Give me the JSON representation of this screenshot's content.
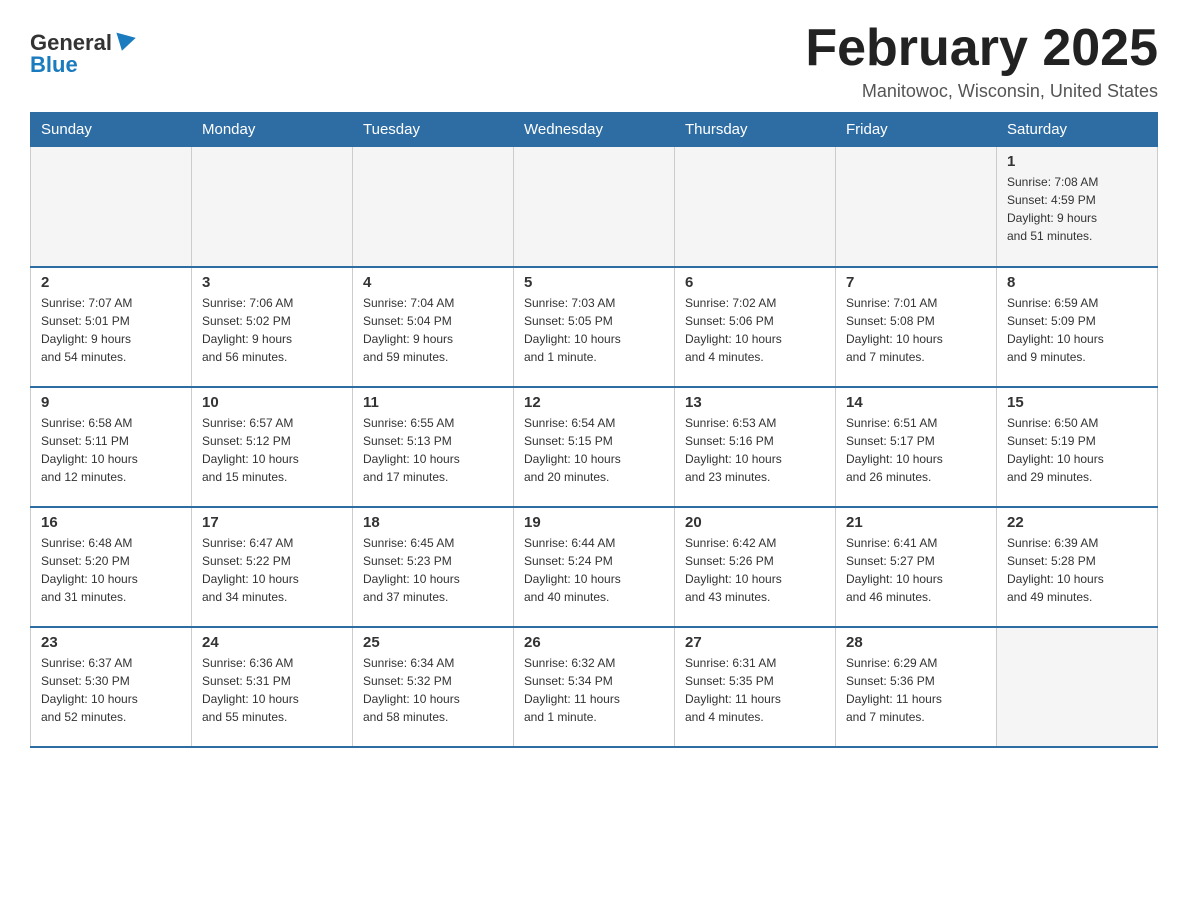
{
  "logo": {
    "text_general": "General",
    "text_blue": "Blue"
  },
  "header": {
    "month_title": "February 2025",
    "location": "Manitowoc, Wisconsin, United States"
  },
  "weekdays": [
    "Sunday",
    "Monday",
    "Tuesday",
    "Wednesday",
    "Thursday",
    "Friday",
    "Saturday"
  ],
  "weeks": [
    [
      {
        "day": "",
        "info": ""
      },
      {
        "day": "",
        "info": ""
      },
      {
        "day": "",
        "info": ""
      },
      {
        "day": "",
        "info": ""
      },
      {
        "day": "",
        "info": ""
      },
      {
        "day": "",
        "info": ""
      },
      {
        "day": "1",
        "info": "Sunrise: 7:08 AM\nSunset: 4:59 PM\nDaylight: 9 hours\nand 51 minutes."
      }
    ],
    [
      {
        "day": "2",
        "info": "Sunrise: 7:07 AM\nSunset: 5:01 PM\nDaylight: 9 hours\nand 54 minutes."
      },
      {
        "day": "3",
        "info": "Sunrise: 7:06 AM\nSunset: 5:02 PM\nDaylight: 9 hours\nand 56 minutes."
      },
      {
        "day": "4",
        "info": "Sunrise: 7:04 AM\nSunset: 5:04 PM\nDaylight: 9 hours\nand 59 minutes."
      },
      {
        "day": "5",
        "info": "Sunrise: 7:03 AM\nSunset: 5:05 PM\nDaylight: 10 hours\nand 1 minute."
      },
      {
        "day": "6",
        "info": "Sunrise: 7:02 AM\nSunset: 5:06 PM\nDaylight: 10 hours\nand 4 minutes."
      },
      {
        "day": "7",
        "info": "Sunrise: 7:01 AM\nSunset: 5:08 PM\nDaylight: 10 hours\nand 7 minutes."
      },
      {
        "day": "8",
        "info": "Sunrise: 6:59 AM\nSunset: 5:09 PM\nDaylight: 10 hours\nand 9 minutes."
      }
    ],
    [
      {
        "day": "9",
        "info": "Sunrise: 6:58 AM\nSunset: 5:11 PM\nDaylight: 10 hours\nand 12 minutes."
      },
      {
        "day": "10",
        "info": "Sunrise: 6:57 AM\nSunset: 5:12 PM\nDaylight: 10 hours\nand 15 minutes."
      },
      {
        "day": "11",
        "info": "Sunrise: 6:55 AM\nSunset: 5:13 PM\nDaylight: 10 hours\nand 17 minutes."
      },
      {
        "day": "12",
        "info": "Sunrise: 6:54 AM\nSunset: 5:15 PM\nDaylight: 10 hours\nand 20 minutes."
      },
      {
        "day": "13",
        "info": "Sunrise: 6:53 AM\nSunset: 5:16 PM\nDaylight: 10 hours\nand 23 minutes."
      },
      {
        "day": "14",
        "info": "Sunrise: 6:51 AM\nSunset: 5:17 PM\nDaylight: 10 hours\nand 26 minutes."
      },
      {
        "day": "15",
        "info": "Sunrise: 6:50 AM\nSunset: 5:19 PM\nDaylight: 10 hours\nand 29 minutes."
      }
    ],
    [
      {
        "day": "16",
        "info": "Sunrise: 6:48 AM\nSunset: 5:20 PM\nDaylight: 10 hours\nand 31 minutes."
      },
      {
        "day": "17",
        "info": "Sunrise: 6:47 AM\nSunset: 5:22 PM\nDaylight: 10 hours\nand 34 minutes."
      },
      {
        "day": "18",
        "info": "Sunrise: 6:45 AM\nSunset: 5:23 PM\nDaylight: 10 hours\nand 37 minutes."
      },
      {
        "day": "19",
        "info": "Sunrise: 6:44 AM\nSunset: 5:24 PM\nDaylight: 10 hours\nand 40 minutes."
      },
      {
        "day": "20",
        "info": "Sunrise: 6:42 AM\nSunset: 5:26 PM\nDaylight: 10 hours\nand 43 minutes."
      },
      {
        "day": "21",
        "info": "Sunrise: 6:41 AM\nSunset: 5:27 PM\nDaylight: 10 hours\nand 46 minutes."
      },
      {
        "day": "22",
        "info": "Sunrise: 6:39 AM\nSunset: 5:28 PM\nDaylight: 10 hours\nand 49 minutes."
      }
    ],
    [
      {
        "day": "23",
        "info": "Sunrise: 6:37 AM\nSunset: 5:30 PM\nDaylight: 10 hours\nand 52 minutes."
      },
      {
        "day": "24",
        "info": "Sunrise: 6:36 AM\nSunset: 5:31 PM\nDaylight: 10 hours\nand 55 minutes."
      },
      {
        "day": "25",
        "info": "Sunrise: 6:34 AM\nSunset: 5:32 PM\nDaylight: 10 hours\nand 58 minutes."
      },
      {
        "day": "26",
        "info": "Sunrise: 6:32 AM\nSunset: 5:34 PM\nDaylight: 11 hours\nand 1 minute."
      },
      {
        "day": "27",
        "info": "Sunrise: 6:31 AM\nSunset: 5:35 PM\nDaylight: 11 hours\nand 4 minutes."
      },
      {
        "day": "28",
        "info": "Sunrise: 6:29 AM\nSunset: 5:36 PM\nDaylight: 11 hours\nand 7 minutes."
      },
      {
        "day": "",
        "info": ""
      }
    ]
  ]
}
